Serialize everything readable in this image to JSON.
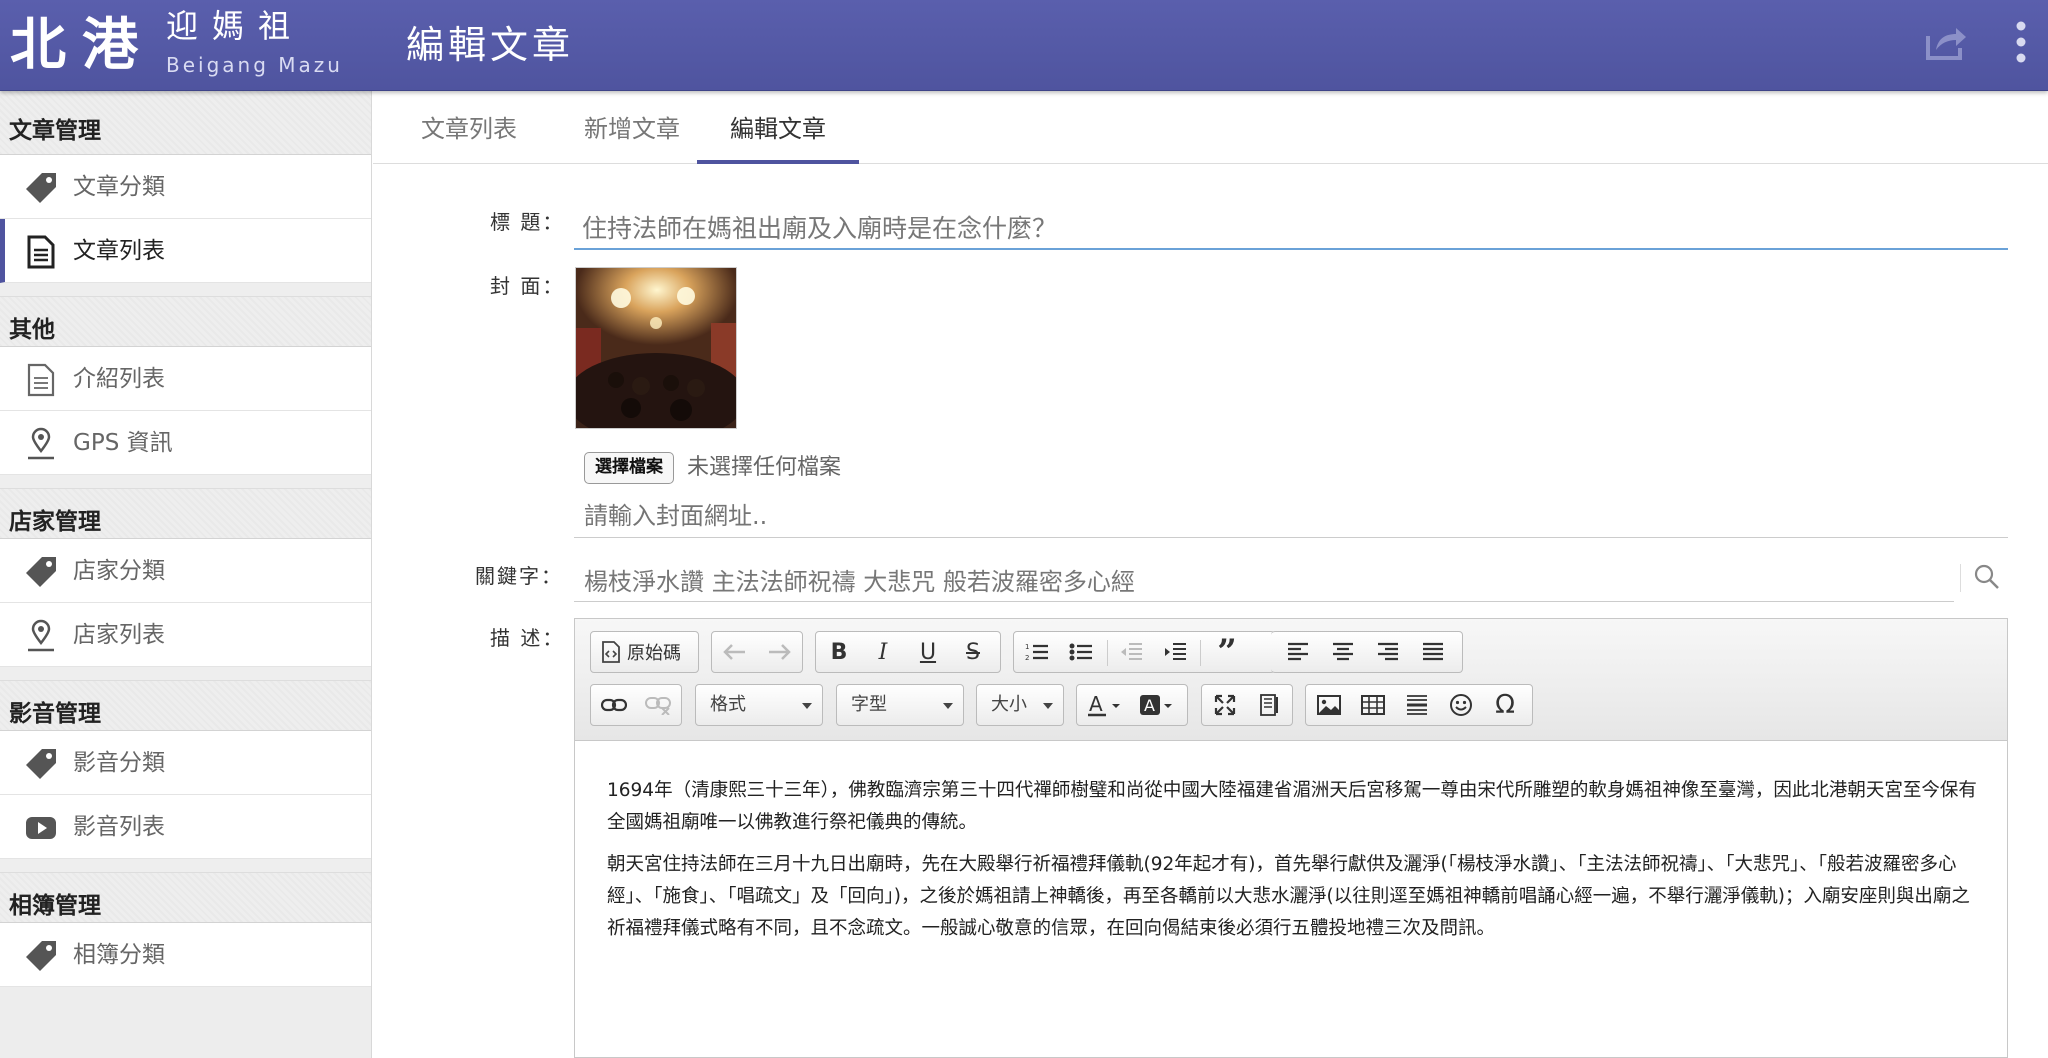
{
  "header": {
    "logo_main": "北港",
    "logo_sub": "迎媽祖",
    "logo_en": "Beigang Mazu",
    "page_title": "編輯文章",
    "share_icon": "share-icon",
    "more_icon": "more-vertical-icon"
  },
  "sidebar": {
    "sections": [
      {
        "title": "文章管理",
        "items": [
          {
            "label": "文章分類",
            "icon": "tag-icon",
            "active": false
          },
          {
            "label": "文章列表",
            "icon": "document-icon",
            "active": true
          }
        ]
      },
      {
        "title": "其他",
        "items": [
          {
            "label": "介紹列表",
            "icon": "document-outline-icon",
            "active": false
          },
          {
            "label": "GPS 資訊",
            "icon": "map-pin-icon",
            "active": false
          }
        ]
      },
      {
        "title": "店家管理",
        "items": [
          {
            "label": "店家分類",
            "icon": "tag-icon",
            "active": false
          },
          {
            "label": "店家列表",
            "icon": "map-pin-icon",
            "active": false
          }
        ]
      },
      {
        "title": "影音管理",
        "items": [
          {
            "label": "影音分類",
            "icon": "tag-icon",
            "active": false
          },
          {
            "label": "影音列表",
            "icon": "youtube-icon",
            "active": false
          }
        ]
      },
      {
        "title": "相簿管理",
        "items": [
          {
            "label": "相簿分類",
            "icon": "tag-icon",
            "active": false
          }
        ]
      }
    ]
  },
  "tabs": [
    {
      "label": "文章列表",
      "active": false
    },
    {
      "label": "新增文章",
      "active": false
    },
    {
      "label": "編輯文章",
      "active": true
    }
  ],
  "form": {
    "title_label": "標 題：",
    "title_value": "住持法師在媽祖出廟及入廟時是在念什麼？",
    "cover_label": "封 面：",
    "file_button": "選擇檔案",
    "file_status": "未選擇任何檔案",
    "cover_url_placeholder": "請輸入封面網址..",
    "keywords_label": "關鍵字：",
    "keywords_value": "楊枝淨水讚 主法法師祝禱 大悲咒 般若波羅密多心經",
    "desc_label": "描 述："
  },
  "editor": {
    "source_label": "原始碼",
    "format_label": "格式",
    "font_label": "字型",
    "size_label": "大小",
    "content": [
      "1694年（清康熙三十三年），佛教臨濟宗第三十四代禪師樹璧和尚從中國大陸福建省湄洲天后宮移駕一尊由宋代所雕塑的軟身媽祖神像至臺灣，因此北港朝天宮至今保有全國媽祖廟唯一以佛教進行祭祀儀典的傳統。",
      "朝天宮住持法師在三月十九日出廟時，先在大殿舉行祈福禮拜儀軌(92年起才有)，首先舉行獻供及灑淨(「楊枝淨水讚」、「主法法師祝禱」、「大悲咒」、「般若波羅密多心經」、「施食」、「唱疏文」及「回向」)，之後於媽祖請上神轎後，再至各轎前以大悲水灑淨(以往則逕至媽祖神轎前唱誦心經一遍，不舉行灑淨儀軌)；入廟安座則與出廟之祈福禮拜儀式略有不同，且不念疏文。一般誠心敬意的信眾，在回向偈結束後必須行五體投地禮三次及問訊。"
    ]
  },
  "colors": {
    "header": "#5257a3",
    "accent": "#4f549f",
    "input_focus": "#6aa2d8"
  }
}
